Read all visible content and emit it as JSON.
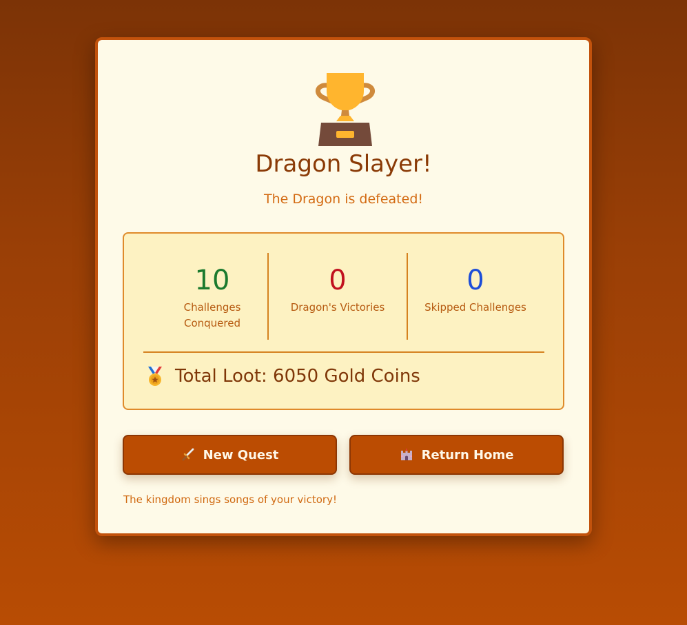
{
  "header": {
    "title": "Dragon Slayer!",
    "subtitle": "The Dragon is defeated!",
    "trophy_icon": "trophy-icon"
  },
  "stats": [
    {
      "value": "10",
      "label": "Challenges Conquered",
      "color": "#1b7a2e"
    },
    {
      "value": "0",
      "label": "Dragon's Victories",
      "color": "#c1121f"
    },
    {
      "value": "0",
      "label": "Skipped Challenges",
      "color": "#1d4ed8"
    }
  ],
  "loot": {
    "text": "Total Loot: 6050 Gold Coins",
    "icon": "medal-icon"
  },
  "buttons": {
    "new_quest": {
      "label": "New Quest",
      "icon": "sword-icon"
    },
    "return_home": {
      "label": "Return Home",
      "icon": "castle-icon"
    }
  },
  "footer": {
    "message": "The kingdom sings songs of your victory!"
  },
  "colors": {
    "card_bg": "#fefae8",
    "card_border": "#c2520c",
    "button_bg": "#bb4c02",
    "title": "#8a3a06",
    "accent": "#d36a12"
  }
}
